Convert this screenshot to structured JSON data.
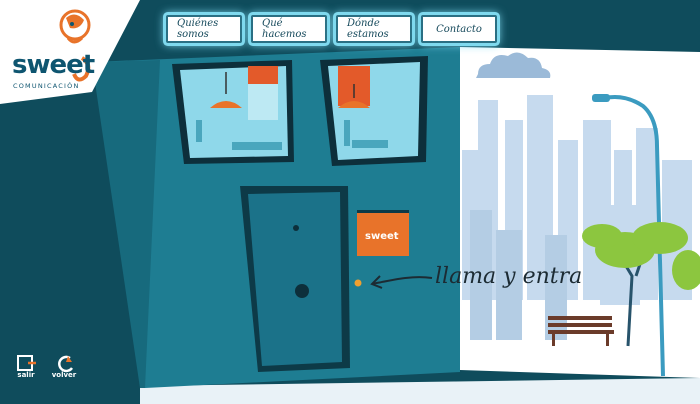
{
  "brand": {
    "name": "sweet",
    "tagline": "COMUNICACIÓN",
    "accent_color": "#e8732a",
    "primary_color": "#0e5570"
  },
  "nav": {
    "items": [
      {
        "label": "Quiénes somos"
      },
      {
        "label": "Qué hacemos"
      },
      {
        "label": "Dónde estamos"
      },
      {
        "label": "Contacto"
      }
    ]
  },
  "door_sign": {
    "text": "sweet"
  },
  "cta": {
    "text": "llama y entra",
    "icon": "arrow-left-icon"
  },
  "footer_controls": {
    "exit_label": "salir",
    "exit_icon": "exit-door-icon",
    "back_label": "volver",
    "back_icon": "back-arrow-icon"
  },
  "colors": {
    "wall": "#1e7d92",
    "sky": "#ffffff",
    "skyline": "#c9dcef",
    "tree": "#8cc63f",
    "background": "#0f4c5c"
  }
}
